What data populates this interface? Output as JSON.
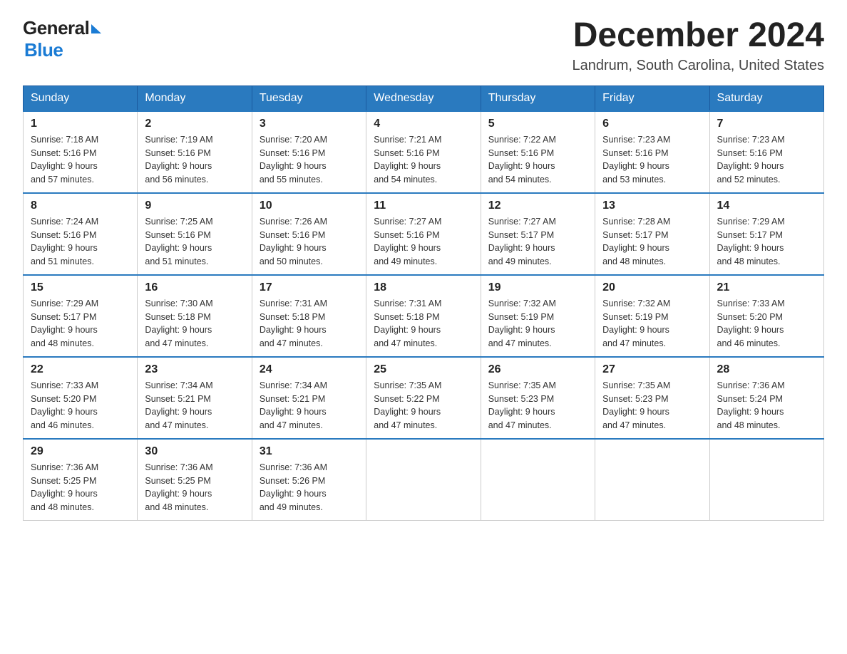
{
  "header": {
    "logo_general": "General",
    "logo_blue": "Blue",
    "month_title": "December 2024",
    "location": "Landrum, South Carolina, United States"
  },
  "days_of_week": [
    "Sunday",
    "Monday",
    "Tuesday",
    "Wednesday",
    "Thursday",
    "Friday",
    "Saturday"
  ],
  "weeks": [
    [
      {
        "day": "1",
        "sunrise": "Sunrise: 7:18 AM",
        "sunset": "Sunset: 5:16 PM",
        "daylight": "Daylight: 9 hours",
        "daylight2": "and 57 minutes."
      },
      {
        "day": "2",
        "sunrise": "Sunrise: 7:19 AM",
        "sunset": "Sunset: 5:16 PM",
        "daylight": "Daylight: 9 hours",
        "daylight2": "and 56 minutes."
      },
      {
        "day": "3",
        "sunrise": "Sunrise: 7:20 AM",
        "sunset": "Sunset: 5:16 PM",
        "daylight": "Daylight: 9 hours",
        "daylight2": "and 55 minutes."
      },
      {
        "day": "4",
        "sunrise": "Sunrise: 7:21 AM",
        "sunset": "Sunset: 5:16 PM",
        "daylight": "Daylight: 9 hours",
        "daylight2": "and 54 minutes."
      },
      {
        "day": "5",
        "sunrise": "Sunrise: 7:22 AM",
        "sunset": "Sunset: 5:16 PM",
        "daylight": "Daylight: 9 hours",
        "daylight2": "and 54 minutes."
      },
      {
        "day": "6",
        "sunrise": "Sunrise: 7:23 AM",
        "sunset": "Sunset: 5:16 PM",
        "daylight": "Daylight: 9 hours",
        "daylight2": "and 53 minutes."
      },
      {
        "day": "7",
        "sunrise": "Sunrise: 7:23 AM",
        "sunset": "Sunset: 5:16 PM",
        "daylight": "Daylight: 9 hours",
        "daylight2": "and 52 minutes."
      }
    ],
    [
      {
        "day": "8",
        "sunrise": "Sunrise: 7:24 AM",
        "sunset": "Sunset: 5:16 PM",
        "daylight": "Daylight: 9 hours",
        "daylight2": "and 51 minutes."
      },
      {
        "day": "9",
        "sunrise": "Sunrise: 7:25 AM",
        "sunset": "Sunset: 5:16 PM",
        "daylight": "Daylight: 9 hours",
        "daylight2": "and 51 minutes."
      },
      {
        "day": "10",
        "sunrise": "Sunrise: 7:26 AM",
        "sunset": "Sunset: 5:16 PM",
        "daylight": "Daylight: 9 hours",
        "daylight2": "and 50 minutes."
      },
      {
        "day": "11",
        "sunrise": "Sunrise: 7:27 AM",
        "sunset": "Sunset: 5:16 PM",
        "daylight": "Daylight: 9 hours",
        "daylight2": "and 49 minutes."
      },
      {
        "day": "12",
        "sunrise": "Sunrise: 7:27 AM",
        "sunset": "Sunset: 5:17 PM",
        "daylight": "Daylight: 9 hours",
        "daylight2": "and 49 minutes."
      },
      {
        "day": "13",
        "sunrise": "Sunrise: 7:28 AM",
        "sunset": "Sunset: 5:17 PM",
        "daylight": "Daylight: 9 hours",
        "daylight2": "and 48 minutes."
      },
      {
        "day": "14",
        "sunrise": "Sunrise: 7:29 AM",
        "sunset": "Sunset: 5:17 PM",
        "daylight": "Daylight: 9 hours",
        "daylight2": "and 48 minutes."
      }
    ],
    [
      {
        "day": "15",
        "sunrise": "Sunrise: 7:29 AM",
        "sunset": "Sunset: 5:17 PM",
        "daylight": "Daylight: 9 hours",
        "daylight2": "and 48 minutes."
      },
      {
        "day": "16",
        "sunrise": "Sunrise: 7:30 AM",
        "sunset": "Sunset: 5:18 PM",
        "daylight": "Daylight: 9 hours",
        "daylight2": "and 47 minutes."
      },
      {
        "day": "17",
        "sunrise": "Sunrise: 7:31 AM",
        "sunset": "Sunset: 5:18 PM",
        "daylight": "Daylight: 9 hours",
        "daylight2": "and 47 minutes."
      },
      {
        "day": "18",
        "sunrise": "Sunrise: 7:31 AM",
        "sunset": "Sunset: 5:18 PM",
        "daylight": "Daylight: 9 hours",
        "daylight2": "and 47 minutes."
      },
      {
        "day": "19",
        "sunrise": "Sunrise: 7:32 AM",
        "sunset": "Sunset: 5:19 PM",
        "daylight": "Daylight: 9 hours",
        "daylight2": "and 47 minutes."
      },
      {
        "day": "20",
        "sunrise": "Sunrise: 7:32 AM",
        "sunset": "Sunset: 5:19 PM",
        "daylight": "Daylight: 9 hours",
        "daylight2": "and 47 minutes."
      },
      {
        "day": "21",
        "sunrise": "Sunrise: 7:33 AM",
        "sunset": "Sunset: 5:20 PM",
        "daylight": "Daylight: 9 hours",
        "daylight2": "and 46 minutes."
      }
    ],
    [
      {
        "day": "22",
        "sunrise": "Sunrise: 7:33 AM",
        "sunset": "Sunset: 5:20 PM",
        "daylight": "Daylight: 9 hours",
        "daylight2": "and 46 minutes."
      },
      {
        "day": "23",
        "sunrise": "Sunrise: 7:34 AM",
        "sunset": "Sunset: 5:21 PM",
        "daylight": "Daylight: 9 hours",
        "daylight2": "and 47 minutes."
      },
      {
        "day": "24",
        "sunrise": "Sunrise: 7:34 AM",
        "sunset": "Sunset: 5:21 PM",
        "daylight": "Daylight: 9 hours",
        "daylight2": "and 47 minutes."
      },
      {
        "day": "25",
        "sunrise": "Sunrise: 7:35 AM",
        "sunset": "Sunset: 5:22 PM",
        "daylight": "Daylight: 9 hours",
        "daylight2": "and 47 minutes."
      },
      {
        "day": "26",
        "sunrise": "Sunrise: 7:35 AM",
        "sunset": "Sunset: 5:23 PM",
        "daylight": "Daylight: 9 hours",
        "daylight2": "and 47 minutes."
      },
      {
        "day": "27",
        "sunrise": "Sunrise: 7:35 AM",
        "sunset": "Sunset: 5:23 PM",
        "daylight": "Daylight: 9 hours",
        "daylight2": "and 47 minutes."
      },
      {
        "day": "28",
        "sunrise": "Sunrise: 7:36 AM",
        "sunset": "Sunset: 5:24 PM",
        "daylight": "Daylight: 9 hours",
        "daylight2": "and 48 minutes."
      }
    ],
    [
      {
        "day": "29",
        "sunrise": "Sunrise: 7:36 AM",
        "sunset": "Sunset: 5:25 PM",
        "daylight": "Daylight: 9 hours",
        "daylight2": "and 48 minutes."
      },
      {
        "day": "30",
        "sunrise": "Sunrise: 7:36 AM",
        "sunset": "Sunset: 5:25 PM",
        "daylight": "Daylight: 9 hours",
        "daylight2": "and 48 minutes."
      },
      {
        "day": "31",
        "sunrise": "Sunrise: 7:36 AM",
        "sunset": "Sunset: 5:26 PM",
        "daylight": "Daylight: 9 hours",
        "daylight2": "and 49 minutes."
      },
      null,
      null,
      null,
      null
    ]
  ]
}
